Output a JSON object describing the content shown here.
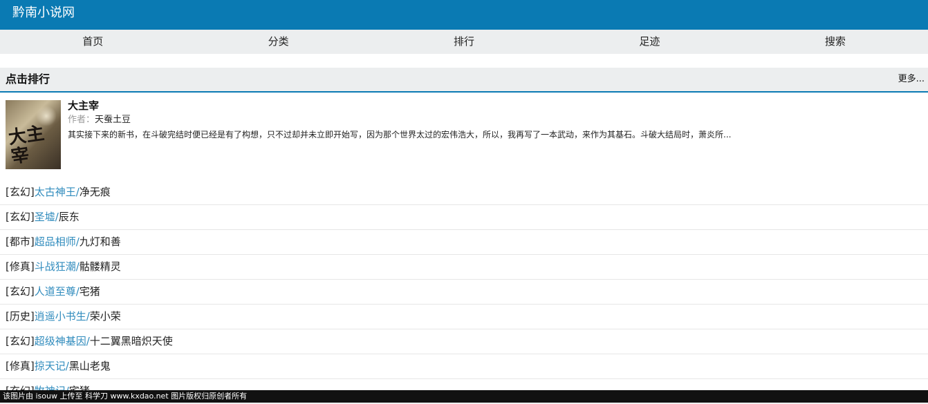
{
  "site": {
    "title": "黔南小说网"
  },
  "nav": {
    "items": [
      {
        "label": "首页"
      },
      {
        "label": "分类"
      },
      {
        "label": "排行"
      },
      {
        "label": "足迹"
      },
      {
        "label": "搜索"
      }
    ]
  },
  "section": {
    "title": "点击排行",
    "more": "更多..."
  },
  "featured": {
    "title": "大主宰",
    "author_prefix": "作者：",
    "author": "天蚕土豆",
    "description": "其实接下来的新书，在斗破完结时便已经是有了构想，只不过却并未立即开始写，因为那个世界太过的宏伟浩大，所以，我再写了一本武动，来作为其基石。斗破大结局时，萧炎所...",
    "cover_text": "大主宰"
  },
  "ranking": [
    {
      "category": "[玄幻]",
      "book": "太古神王",
      "sep": "/",
      "author": "净无痕"
    },
    {
      "category": "[玄幻]",
      "book": "圣墟",
      "sep": "/",
      "author": "辰东"
    },
    {
      "category": "[都市]",
      "book": "超品相师",
      "sep": "/",
      "author": "九灯和善"
    },
    {
      "category": "[修真]",
      "book": "斗战狂潮",
      "sep": "/",
      "author": "骷髅精灵"
    },
    {
      "category": "[玄幻]",
      "book": "人道至尊",
      "sep": "/",
      "author": "宅猪"
    },
    {
      "category": "[历史]",
      "book": "逍遥小书生",
      "sep": "/",
      "author": "荣小荣"
    },
    {
      "category": "[玄幻]",
      "book": "超级神基因",
      "sep": "/",
      "author": "十二翼黑暗炽天使"
    },
    {
      "category": "[修真]",
      "book": "掠天记",
      "sep": "/",
      "author": "黑山老鬼"
    },
    {
      "category": "[玄幻]",
      "book": "牧神记",
      "sep": "/",
      "author": "宅猪"
    }
  ],
  "footer": {
    "text": "该图片由 isouw 上传至 科学刀 www.kxdao.net 图片版权归原创者所有"
  }
}
